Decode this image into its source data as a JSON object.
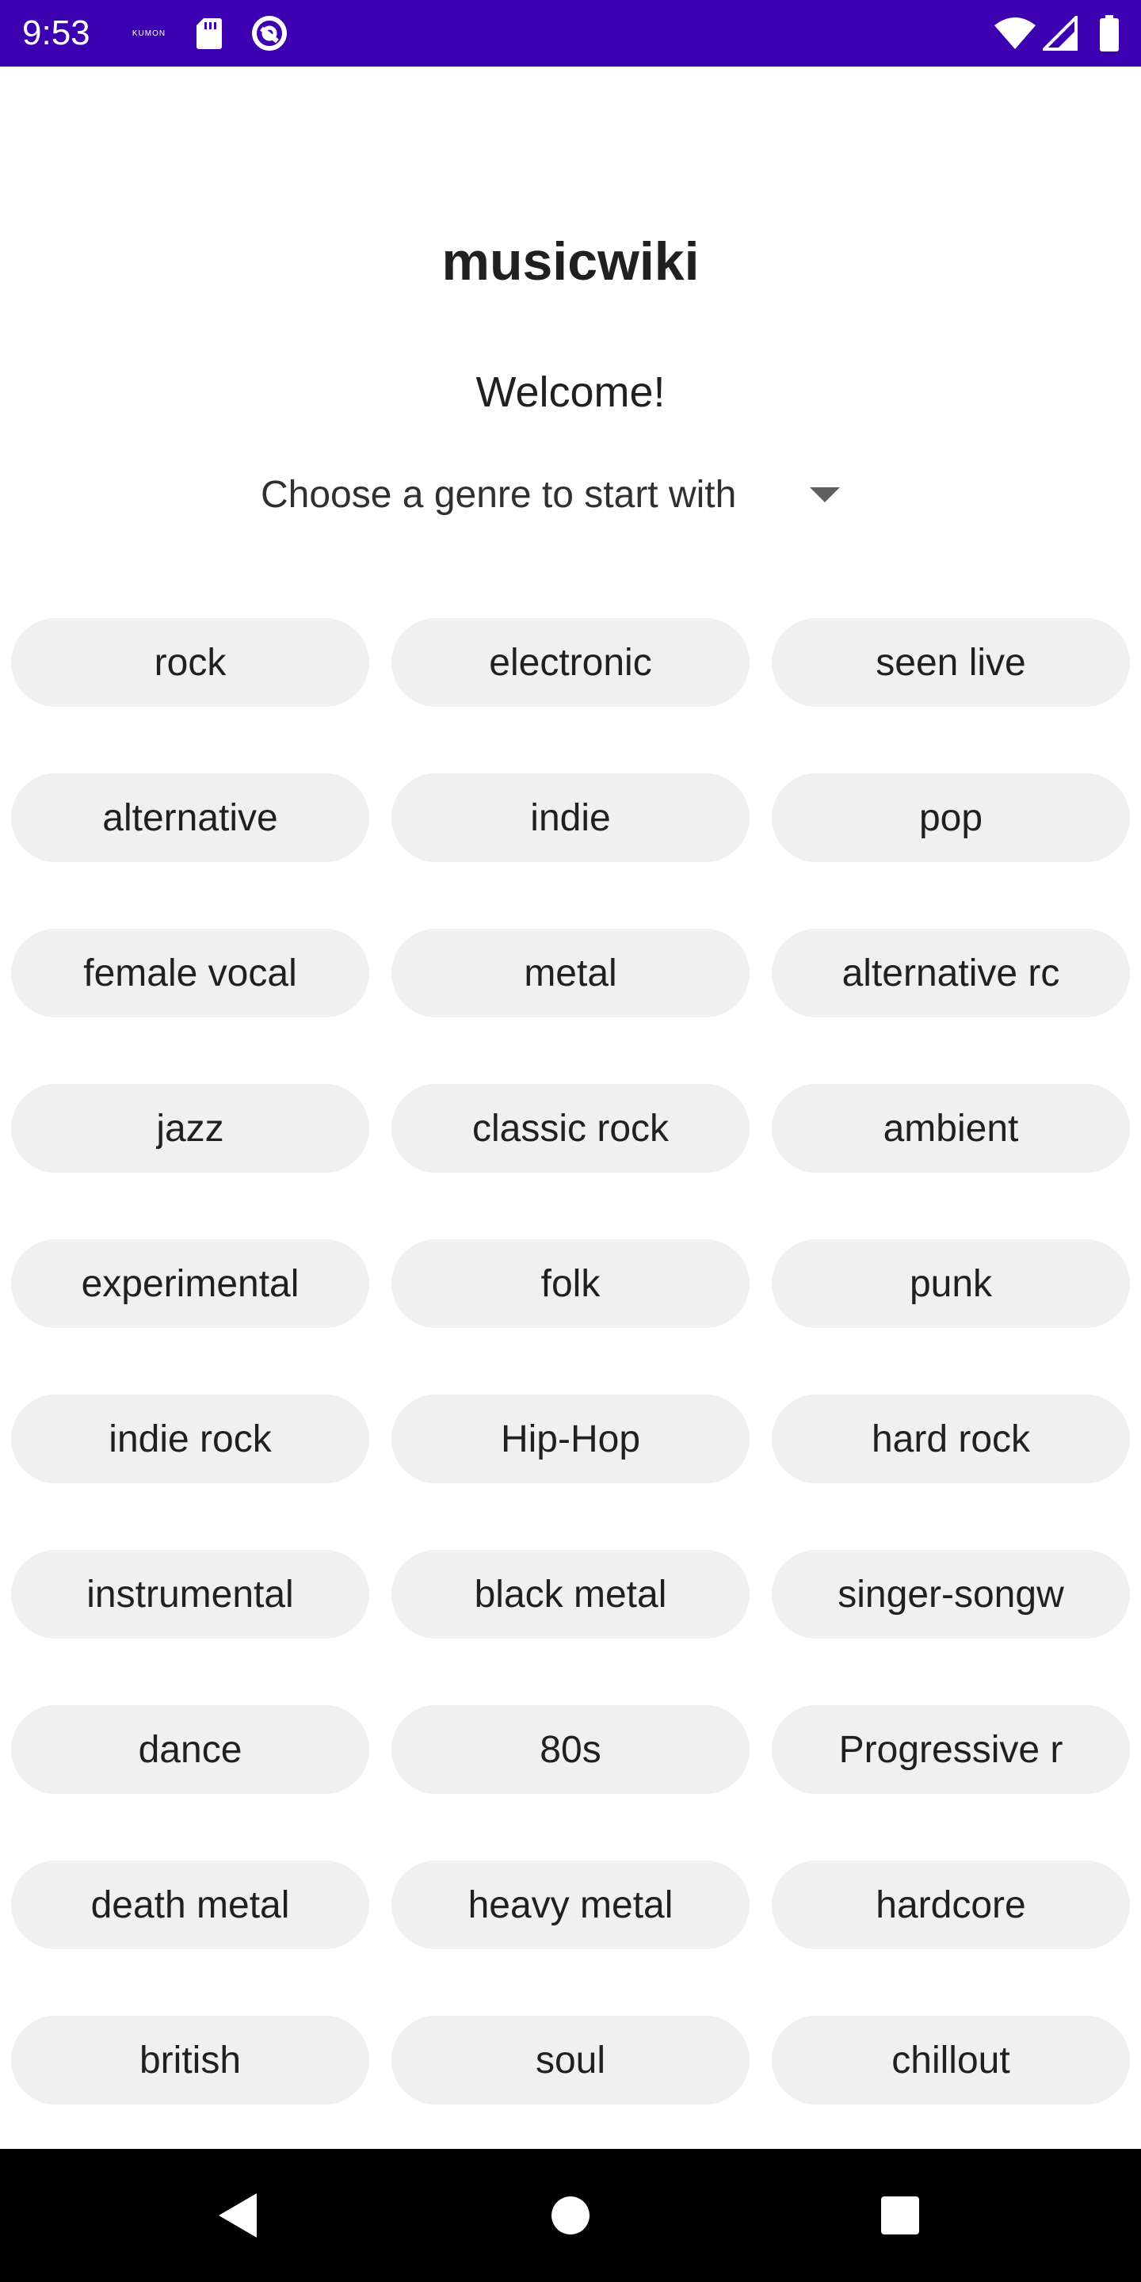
{
  "status_bar": {
    "time": "9:53",
    "notification_icons": [
      "kumon-icon",
      "sd-card-icon",
      "sync-icon"
    ],
    "kumon_text": "KUMON",
    "system_icons": [
      "wifi-icon",
      "signal-icon",
      "battery-icon"
    ],
    "background_color": "#3d00b0"
  },
  "header": {
    "title": "musicwiki",
    "welcome": "Welcome!",
    "genre_prompt": "Choose a genre to start with"
  },
  "genres": [
    "rock",
    "electronic",
    "seen live",
    "alternative",
    "indie",
    "pop",
    "female vocal",
    "metal",
    "alternative rc",
    "jazz",
    "classic rock",
    "ambient",
    "experimental",
    "folk",
    "punk",
    "indie rock",
    "Hip-Hop",
    "hard rock",
    "instrumental",
    "black metal",
    "singer-songw",
    "dance",
    "80s",
    "Progressive r",
    "death metal",
    "heavy metal",
    "hardcore",
    "british",
    "soul",
    "chillout"
  ],
  "nav_bar": {
    "buttons": [
      "back-icon",
      "home-icon",
      "recents-icon"
    ]
  },
  "colors": {
    "chip_background": "#f0f0f0",
    "text": "#202020",
    "nav_background": "#000000"
  }
}
